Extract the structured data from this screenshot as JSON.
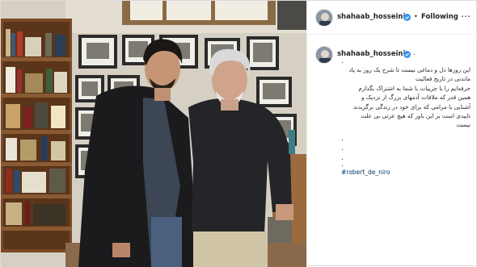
{
  "post": {
    "author": {
      "username": "shahaab_hosseini",
      "verified": true,
      "follow_separator": "•",
      "follow_label": "Following",
      "avatar_icon": "profile-photo"
    },
    "more_icon": "more-options-icon",
    "caption": {
      "username": "shahaab_hosseini",
      "lines": [
        "این روزها دل و دماغی نیست تا شرح یک روز به یاد",
        "ماندنی در تاریخ فعالیت",
        "حرفه‌ایم را با جزییات با شما به اشتراک بگذارم",
        "همین قدر که ملاقات آدمهای بزرگ از نزدیک و",
        "آشنایی با مرامی که برای خود در زندگی برگزیدند",
        "تاییدی است بر این باور که هیچ عزتی بی علت",
        "نیست"
      ],
      "spacer_dots": [
        ".",
        ".",
        ".",
        "."
      ],
      "hashtag": "#robert_de_niro"
    },
    "colors": {
      "verified_badge": "#3897f0",
      "link": "#00376b",
      "text": "#262626",
      "border": "#dbdbdb"
    }
  }
}
